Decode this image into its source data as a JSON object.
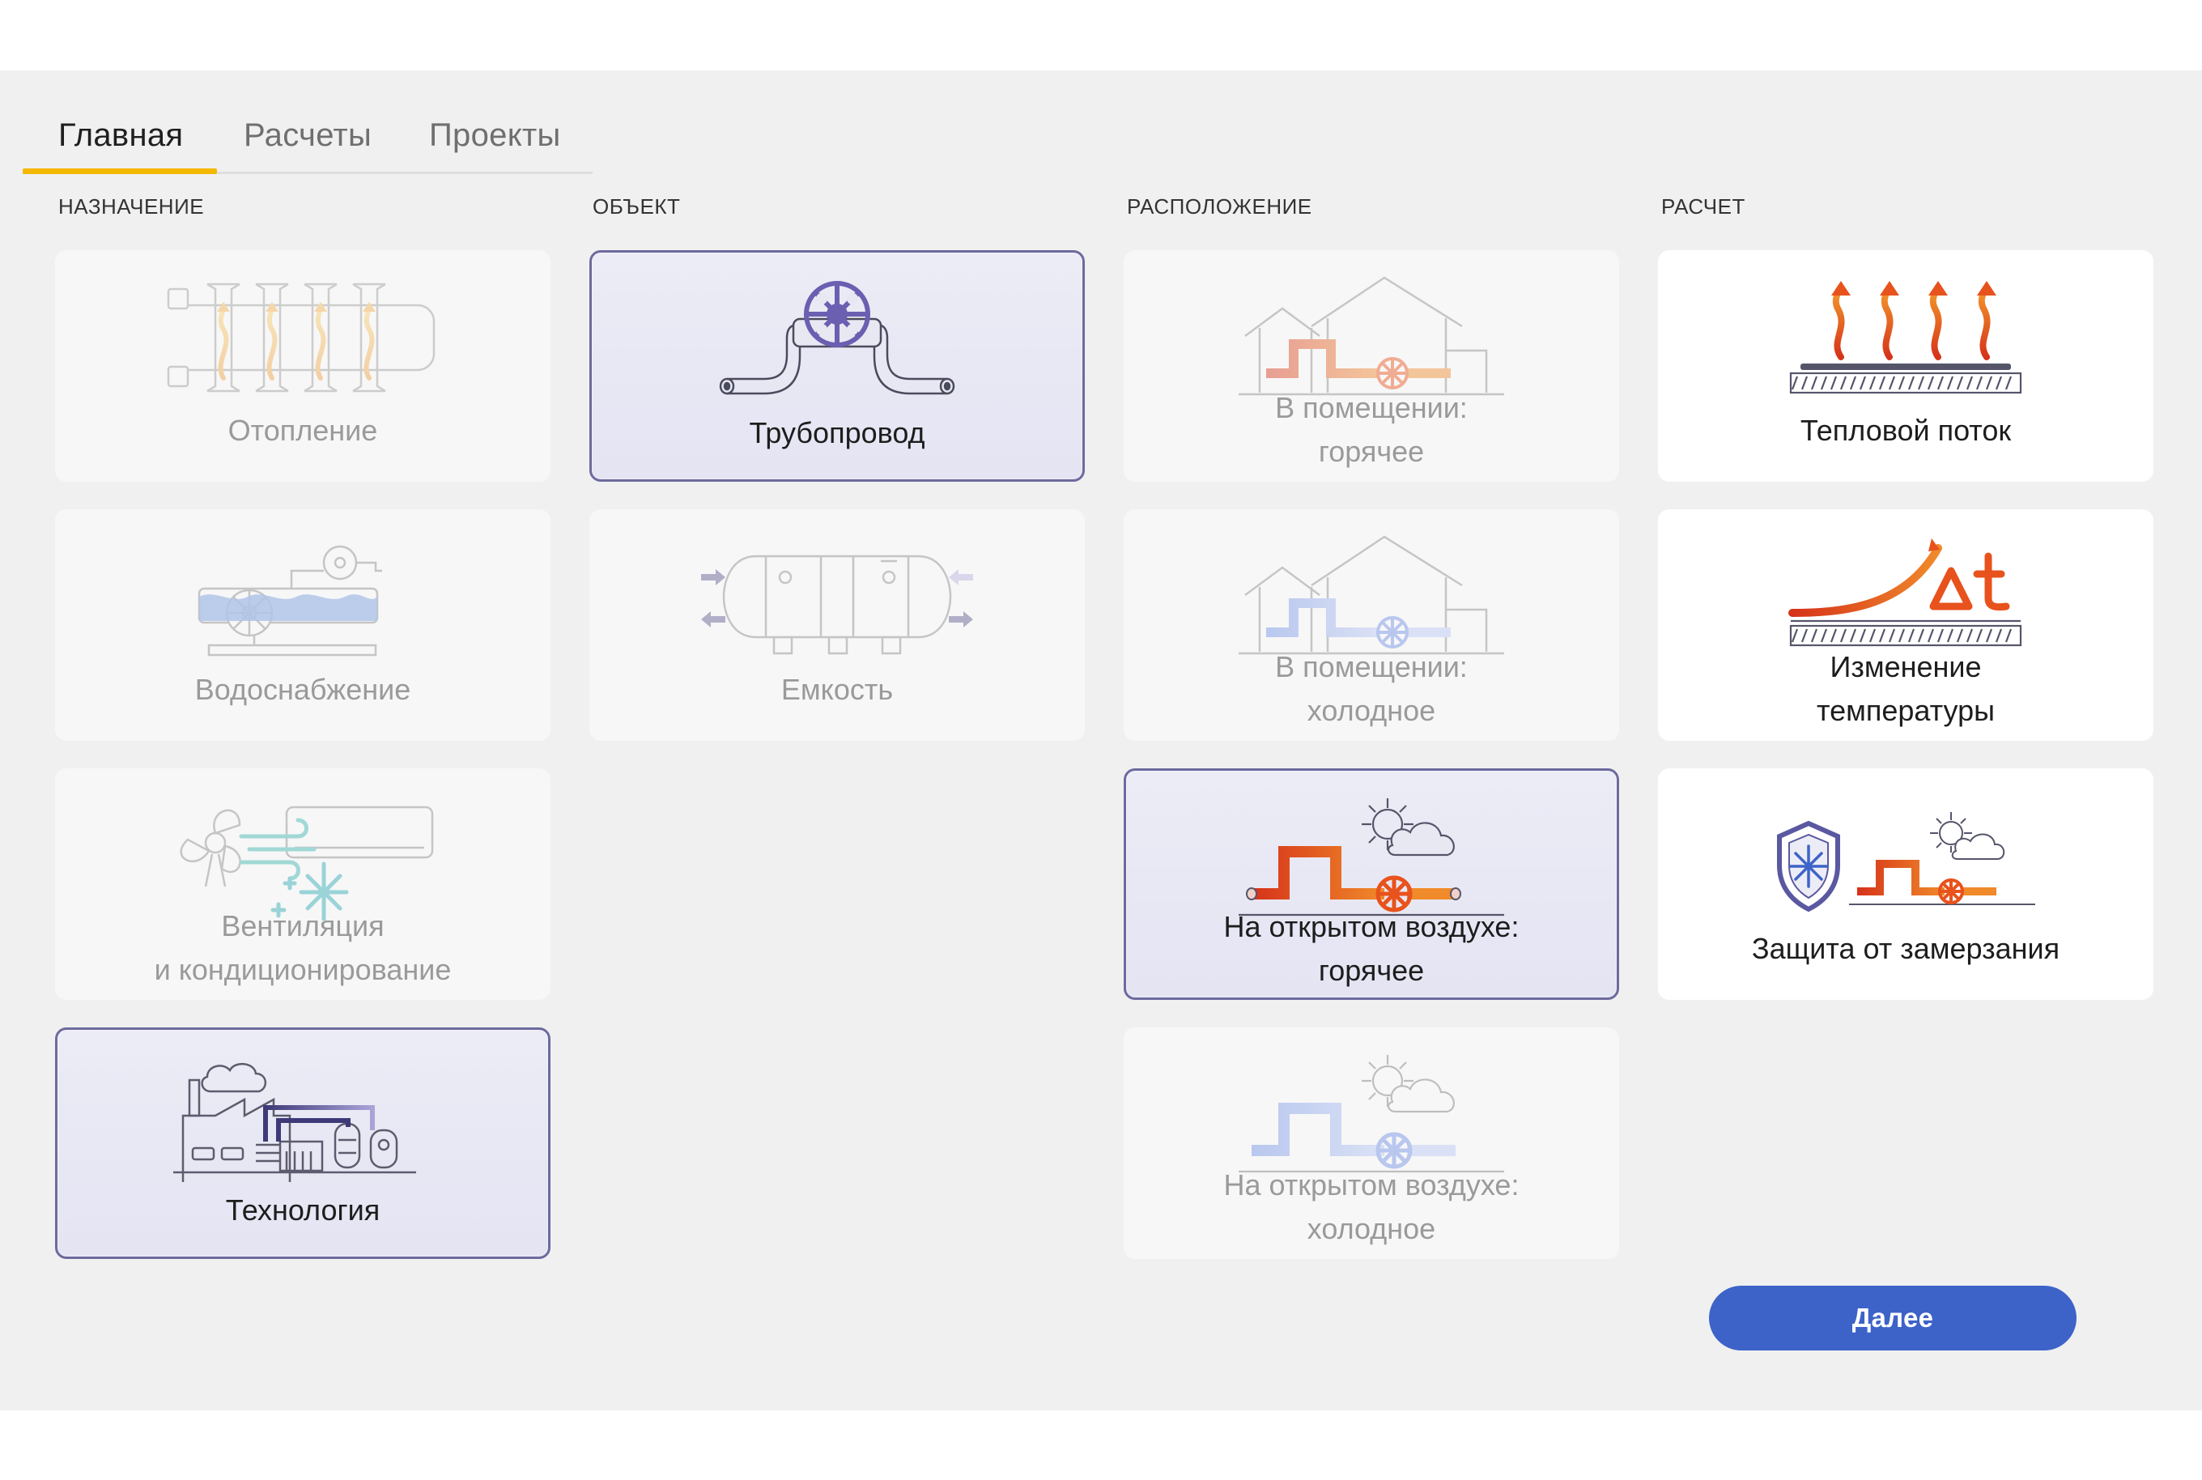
{
  "tabs": [
    {
      "label": "Главная",
      "active": true
    },
    {
      "label": "Расчеты",
      "active": false
    },
    {
      "label": "Проекты",
      "active": false
    }
  ],
  "columns": {
    "purpose": {
      "heading": "НАЗНАЧЕНИЕ",
      "items": [
        {
          "label1": "Отопление",
          "label2": "",
          "icon": "radiator-icon",
          "state": "disabled"
        },
        {
          "label1": "Водоснабжение",
          "label2": "",
          "icon": "water-supply-icon",
          "state": "disabled"
        },
        {
          "label1": "Вентиляция",
          "label2": "и кондиционирование",
          "icon": "ventilation-icon",
          "state": "disabled"
        },
        {
          "label1": "Технология",
          "label2": "",
          "icon": "factory-icon",
          "state": "selected"
        }
      ]
    },
    "object": {
      "heading": "ОБЪЕКТ",
      "items": [
        {
          "label1": "Трубопровод",
          "label2": "",
          "icon": "pipeline-icon",
          "state": "selected"
        },
        {
          "label1": "Емкость",
          "label2": "",
          "icon": "tank-icon",
          "state": "disabled"
        }
      ]
    },
    "location": {
      "heading": "РАСПОЛОЖЕНИЕ",
      "items": [
        {
          "label1": "В помещении:",
          "label2": "горячее",
          "icon": "indoor-hot-icon",
          "state": "disabled"
        },
        {
          "label1": "В помещении:",
          "label2": "холодное",
          "icon": "indoor-cold-icon",
          "state": "disabled"
        },
        {
          "label1": "На открытом воздухе:",
          "label2": "горячее",
          "icon": "outdoor-hot-icon",
          "state": "selected"
        },
        {
          "label1": "На открытом воздухе:",
          "label2": "холодное",
          "icon": "outdoor-cold-icon",
          "state": "disabled"
        }
      ]
    },
    "calculation": {
      "heading": "РАСЧЕТ",
      "items": [
        {
          "label1": "Тепловой поток",
          "label2": "",
          "icon": "heat-flow-icon",
          "state": "enabled"
        },
        {
          "label1": "Изменение",
          "label2": "температуры",
          "icon": "delta-t-icon",
          "state": "enabled"
        },
        {
          "label1": "Защита от замерзания",
          "label2": "",
          "icon": "frost-protection-icon",
          "state": "enabled"
        }
      ]
    }
  },
  "next_button": {
    "label": "Далее"
  },
  "colors": {
    "accent_tab": "#f5b800",
    "button": "#3d63c9",
    "selected_border": "#6d6a9e",
    "hot": "#e8521c",
    "cold": "#8aa6ee"
  }
}
